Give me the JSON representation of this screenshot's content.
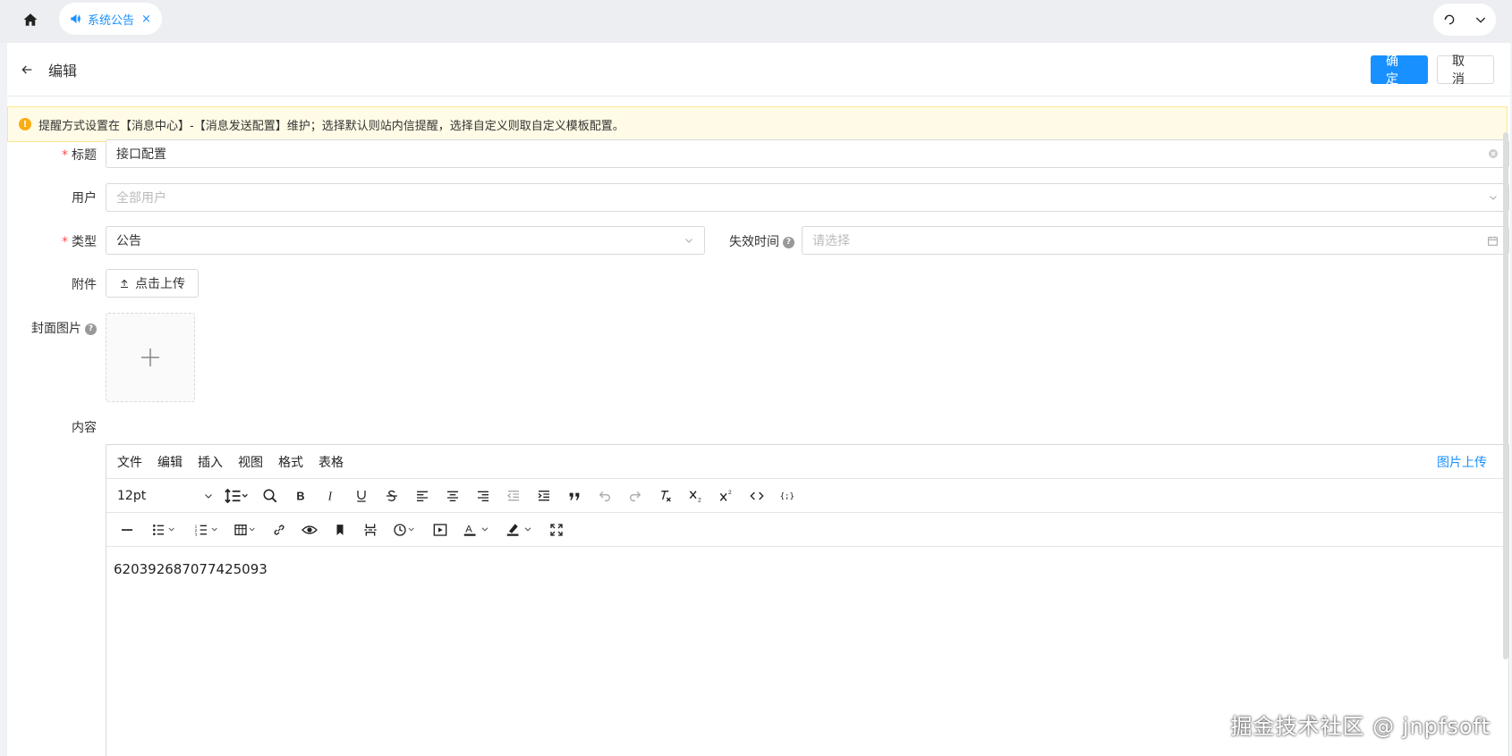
{
  "tabs": {
    "active_tab": {
      "label": "系统公告",
      "close": "×"
    }
  },
  "header": {
    "title": "编辑",
    "confirm_label": "确 定",
    "cancel_label": "取 消"
  },
  "alert": {
    "text": "提醒方式设置在【消息中心】-【消息发送配置】维护；选择默认则站内信提醒，选择自定义则取自定义模板配置。"
  },
  "form": {
    "title_label": "标题",
    "title_value": "接口配置",
    "user_label": "用户",
    "user_placeholder": "全部用户",
    "type_label": "类型",
    "type_value": "公告",
    "expire_label": "失效时间",
    "expire_placeholder": "请选择",
    "attachment_label": "附件",
    "upload_label": "点击上传",
    "cover_label": "封面图片",
    "content_label": "内容"
  },
  "editor": {
    "menu": [
      "文件",
      "编辑",
      "插入",
      "视图",
      "格式",
      "表格"
    ],
    "image_upload": "图片上传",
    "font_size": "12pt",
    "content": "620392687077425093"
  },
  "watermark": "掘金技术社区 @ jnpfsoft",
  "colors": {
    "primary": "#1890ff",
    "required": "#ff4d4f",
    "alert_bg": "#fffbe6",
    "alert_border": "#ffe58f"
  }
}
